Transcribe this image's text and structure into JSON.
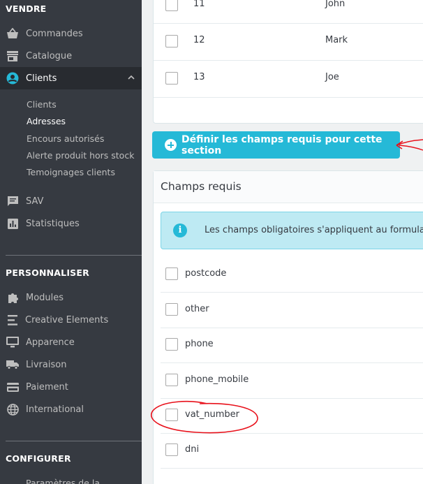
{
  "sidebar": {
    "sections": {
      "vendre": "VENDRE",
      "personnaliser": "PERSONNALISER",
      "configurer": "CONFIGURER"
    },
    "vendre_items": [
      {
        "label": "Commandes",
        "icon": "basket-icon"
      },
      {
        "label": "Catalogue",
        "icon": "store-icon"
      },
      {
        "label": "Clients",
        "icon": "account-circle-icon"
      }
    ],
    "clients_sub": [
      "Clients",
      "Adresses",
      "Encours autorisés",
      "Alerte produit hors stock",
      "Temoignages clients"
    ],
    "vendre_items_after": [
      {
        "label": "SAV",
        "icon": "message-icon"
      },
      {
        "label": "Statistiques",
        "icon": "chart-icon"
      }
    ],
    "personnaliser_items": [
      {
        "label": "Modules",
        "icon": "puzzle-icon"
      },
      {
        "label": "Creative Elements",
        "icon": "menu-lines-icon"
      },
      {
        "label": "Apparence",
        "icon": "desktop-icon"
      },
      {
        "label": "Livraison",
        "icon": "truck-icon"
      },
      {
        "label": "Paiement",
        "icon": "credit-card-icon"
      },
      {
        "label": "International",
        "icon": "globe-icon"
      }
    ],
    "configurer_partial": "Paramètres de la"
  },
  "table": {
    "rows": [
      {
        "id": "11",
        "name": "John"
      },
      {
        "id": "12",
        "name": "Mark"
      },
      {
        "id": "13",
        "name": "Joe"
      }
    ]
  },
  "required_button_label": "Définir les champs requis pour cette section",
  "required_card": {
    "title": "Champs requis",
    "info_text": "Les champs obligatoires s'appliquent au formulaire",
    "fields": [
      "postcode",
      "other",
      "phone",
      "phone_mobile",
      "vat_number",
      "dni"
    ]
  },
  "colors": {
    "sidebar_bg": "#363a41",
    "active_bg": "#282b30",
    "primary": "#25b9d7",
    "annotation": "#e8111b"
  }
}
